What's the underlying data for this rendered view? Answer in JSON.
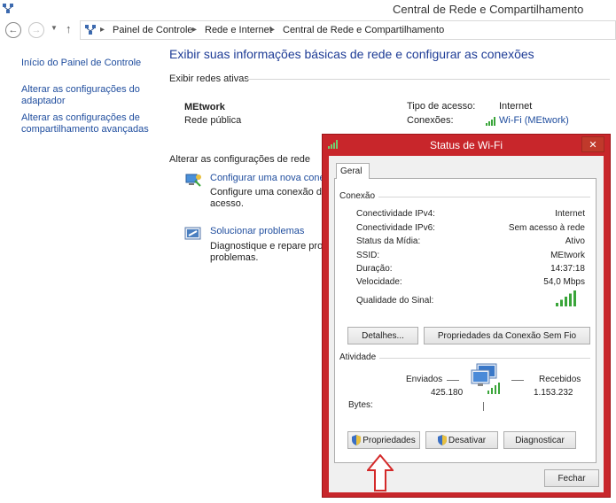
{
  "window": {
    "title": "Central de Rede e Compartilhamento"
  },
  "navbar": {
    "back_icon": "back-arrow-icon",
    "breadcrumbs": [
      "Painel de Controle",
      "Rede e Internet",
      "Central de Rede e Compartilhamento"
    ]
  },
  "sidebar": {
    "items": [
      {
        "label": "Início do Painel de Controle"
      },
      {
        "label_line1": "Alterar as configurações do",
        "label_line2": "adaptador"
      },
      {
        "label_line1": "Alterar as configurações de",
        "label_line2": "compartilhamento avançadas"
      }
    ]
  },
  "main": {
    "heading": "Exibir suas informações básicas de rede e configurar as conexões",
    "active_networks_label": "Exibir redes ativas",
    "network_name": "MEtwork",
    "network_type": "Rede pública",
    "access_type_label": "Tipo de acesso:",
    "access_type_value": "Internet",
    "connections_label": "Conexões:",
    "connections_value": "Wi-Fi (MEtwork)",
    "change_settings_label": "Alterar as configurações de rede",
    "tasks": [
      {
        "title": "Configurar uma nova conex",
        "desc_line1": "Configure uma conexão de",
        "desc_line2": "acesso."
      },
      {
        "title": "Solucionar problemas",
        "desc_line1": "Diagnostique e repare probl",
        "desc_line2": "problemas."
      }
    ]
  },
  "dialog": {
    "title": "Status de Wi-Fi",
    "close_label": "✕",
    "tab": "Geral",
    "connection_group": "Conexão",
    "rows": [
      {
        "label": "Conectividade IPv4:",
        "value": "Internet"
      },
      {
        "label": "Conectividade IPv6:",
        "value": "Sem acesso à rede"
      },
      {
        "label": "Status da Mídia:",
        "value": "Ativo"
      },
      {
        "label": "SSID:",
        "value": "MEtwork"
      },
      {
        "label": "Duração:",
        "value": "14:37:18"
      },
      {
        "label": "Velocidade:",
        "value": "54,0 Mbps"
      }
    ],
    "signal_label": "Qualidade do Sinal:",
    "signal_bars": 5,
    "details_button": "Detalhes...",
    "wireless_props_button": "Propriedades da Conexão Sem Fio",
    "activity_group": "Atividade",
    "sent_label": "Enviados",
    "received_label": "Recebidos",
    "bytes_label": "Bytes:",
    "bytes_sent": "425.180",
    "bytes_received": "1.153.232",
    "properties_button": "Propriedades",
    "disable_button": "Desativar",
    "diagnose_button": "Diagnosticar",
    "close_button": "Fechar"
  },
  "colors": {
    "link": "#1f4d9e",
    "heading": "#1e3c96",
    "highlight_red": "#c8262b",
    "signal_green": "#3aa53a"
  }
}
